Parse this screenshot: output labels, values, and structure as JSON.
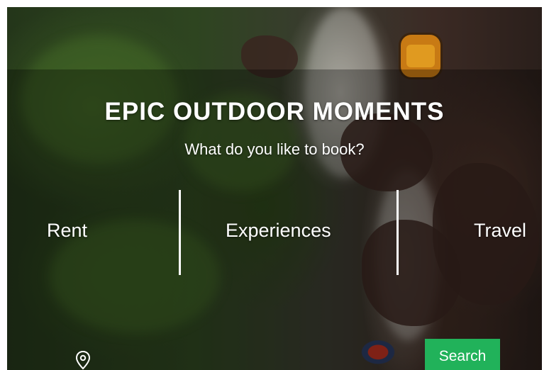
{
  "hero": {
    "headline": "EPIC OUTDOOR MOMENTS",
    "subheadline": "What do you like to book?"
  },
  "categories": [
    {
      "label": "Rent"
    },
    {
      "label": "Experiences"
    },
    {
      "label": "Travel"
    }
  ],
  "search": {
    "button_label": "Search",
    "location_icon": "map-pin-icon"
  },
  "colors": {
    "search_button": "#21b25a",
    "text": "#ffffff"
  }
}
